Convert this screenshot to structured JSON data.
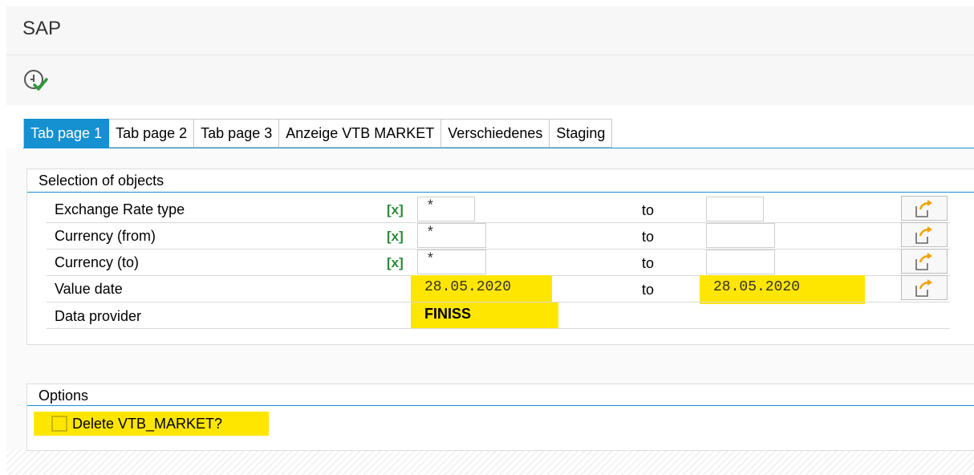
{
  "app": {
    "title": "SAP"
  },
  "tabs": [
    {
      "label": "Tab page 1",
      "active": true
    },
    {
      "label": "Tab page 2",
      "active": false
    },
    {
      "label": "Tab page 3",
      "active": false
    },
    {
      "label": "Anzeige VTB MARKET",
      "active": false
    },
    {
      "label": "Verschiedenes",
      "active": false
    },
    {
      "label": "Staging",
      "active": false
    }
  ],
  "selection": {
    "title": "Selection of objects",
    "to_label": "to",
    "multi_label": "[x]",
    "rows": [
      {
        "label": "Exchange Rate type",
        "from": "*",
        "to": ""
      },
      {
        "label": "Currency (from)",
        "from": "*",
        "to": ""
      },
      {
        "label": "Currency (to)",
        "from": "*",
        "to": ""
      },
      {
        "label": "Value date",
        "from": "28.05.2020",
        "to": "28.05.2020"
      },
      {
        "label": "Data provider",
        "from": "FINISS"
      }
    ]
  },
  "options": {
    "title": "Options",
    "checkbox_label": "Delete VTB_MARKET?",
    "checked": false
  },
  "colors": {
    "accent": "#1590d0",
    "highlight": "#ffe600",
    "multi": "#2a8a3a",
    "arrow": "#f0a30a"
  },
  "icons": [
    "execute-icon",
    "multiple-selection-icon"
  ]
}
